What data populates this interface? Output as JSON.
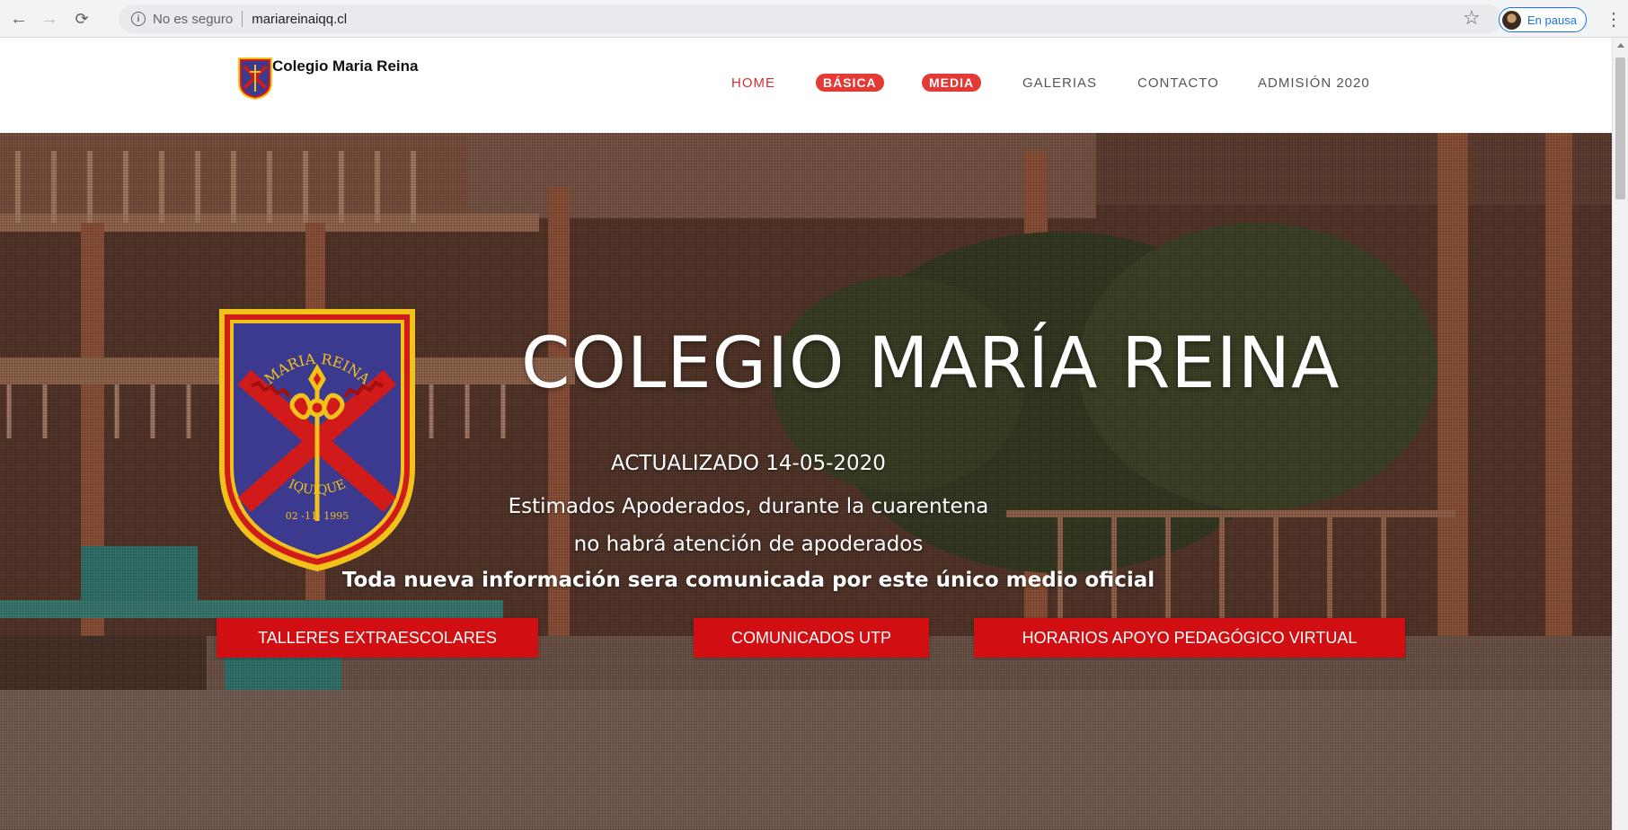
{
  "browser": {
    "security_label": "No es seguro",
    "url": "mariareinaiqq.cl",
    "profile_label": "En pausa"
  },
  "site": {
    "brand": "Colegio Maria Reina",
    "menu": [
      {
        "label": "HOME",
        "style": "active"
      },
      {
        "label": "BÁSICA",
        "style": "pill"
      },
      {
        "label": "MEDIA",
        "style": "pill"
      },
      {
        "label": "GALERIAS",
        "style": "normal"
      },
      {
        "label": "CONTACTO",
        "style": "normal"
      },
      {
        "label": "ADMISIÓN 2020",
        "style": "normal"
      }
    ]
  },
  "hero": {
    "title": "COLEGIO MARÍA REINA",
    "line1": "ACTUALIZADO 14-05-2020",
    "line2": "Estimados Apoderados, durante la cuarentena",
    "line3": "no habrá atención de apoderados",
    "line4": "Toda nueva información sera comunicada por este único medio oficial",
    "buttons": [
      {
        "label": "TALLERES EXTRAESCOLARES"
      },
      {
        "label": "COMUNICADOS UTP"
      },
      {
        "label": "HORARIOS APOYO PEDAGÓGICO VIRTUAL"
      }
    ],
    "crest": {
      "top_text": "MARIA REINA",
      "bottom_text": "IQUIQUE",
      "date": "02 -11- 1995"
    }
  },
  "colors": {
    "accent_red": "#d10f12",
    "menu_pill": "#e53935",
    "crest_blue": "#3b3a8f",
    "crest_gold": "#f2c21a"
  }
}
